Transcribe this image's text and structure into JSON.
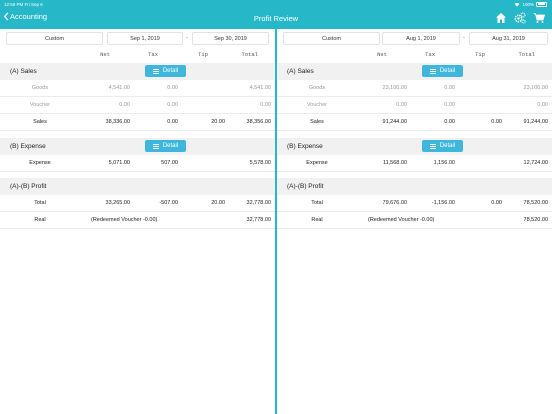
{
  "status": {
    "time": "12:59 PM  Fri Sep 6",
    "battery": "100%"
  },
  "nav": {
    "back_label": "Accounting",
    "title": "Profit Review"
  },
  "headers": {
    "net": "Net",
    "tax": "Tax",
    "tip": "Tip",
    "total": "Total"
  },
  "labels": {
    "sales": "(A) Sales",
    "expense": "(B) Expense",
    "profit": "(A)-(B) Profit",
    "detail": "Detail",
    "goods": "Goods",
    "voucher": "Voucher",
    "sales_row": "Sales",
    "expense_row": "Expense",
    "total_row": "Total",
    "real_row": "Real",
    "dash": "-"
  },
  "left": {
    "mode": "Custom",
    "start": "Sep 1, 2019",
    "end": "Sep 30, 2019",
    "goods": {
      "net": "4,541.00",
      "tax": "0.00",
      "total": "4,541.00"
    },
    "voucher": {
      "net": "0.00",
      "tax": "0.00",
      "total": "0.00"
    },
    "sales": {
      "net": "38,336.00",
      "tax": "0.00",
      "tip": "20.00",
      "total": "38,356.00"
    },
    "expense": {
      "net": "5,071.00",
      "tax": "507.00",
      "total": "5,578.00"
    },
    "total": {
      "net": "33,265.00",
      "tax": "-507.00",
      "tip": "20.00",
      "total": "32,778.00"
    },
    "real": {
      "note": "(Redeemed Voucher -0.00)",
      "total": "32,778.00"
    }
  },
  "right": {
    "mode": "Custom",
    "start": "Aug 1, 2019",
    "end": "Aug 31, 2019",
    "goods": {
      "net": "23,100.00",
      "tax": "0.00",
      "total": "23,100.00"
    },
    "voucher": {
      "net": "0.00",
      "tax": "0.00",
      "total": "0.00"
    },
    "sales": {
      "net": "91,244.00",
      "tax": "0.00",
      "tip": "0.00",
      "total": "91,244.00"
    },
    "expense": {
      "net": "11,568.00",
      "tax": "1,156.00",
      "total": "12,724.00"
    },
    "total": {
      "net": "79,676.00",
      "tax": "-1,156.00",
      "tip": "0.00",
      "total": "78,520.00"
    },
    "real": {
      "note": "(Redeemed Voucher -0.00)",
      "total": "78,520.00"
    }
  },
  "colors": {
    "accent": "#26b7c8",
    "button": "#3fb7dc"
  }
}
